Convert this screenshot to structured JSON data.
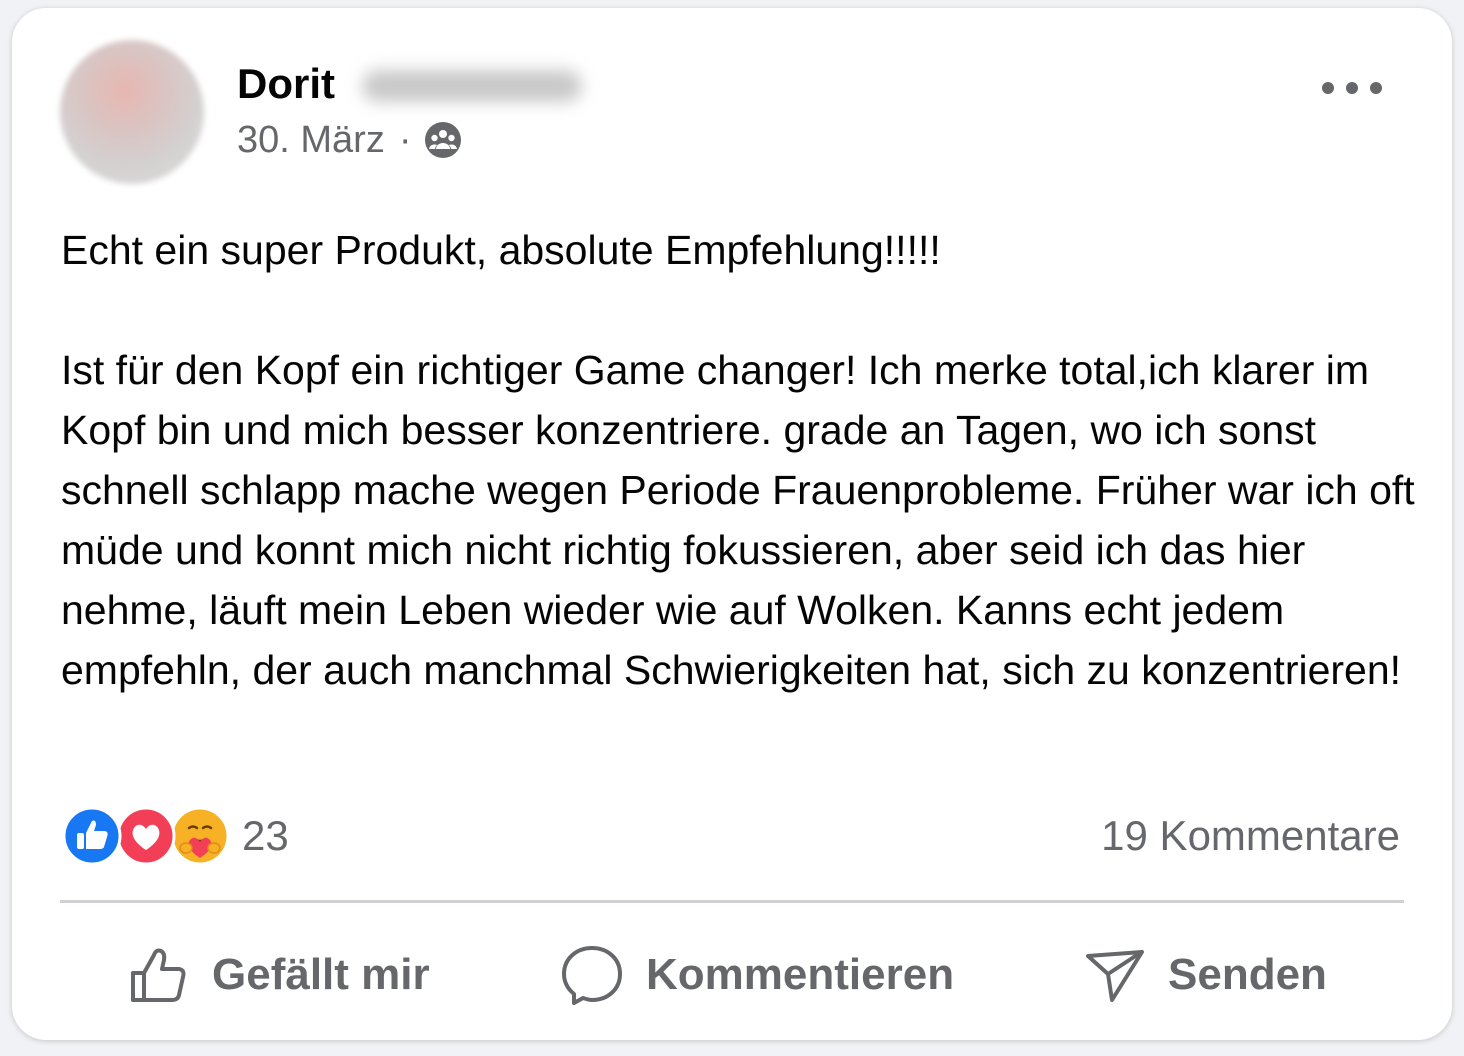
{
  "post": {
    "author_first_name": "Dorit",
    "date": "30. März",
    "separator": "·",
    "audience_icon": "group-icon",
    "more_icon": "more-options-icon",
    "paragraphs": [
      "Echt ein super Produkt, absolute Empfehlung!!!!!",
      "Ist für den Kopf ein richtiger Game changer! Ich merke total,ich klarer im Kopf bin und mich besser konzentriere. grade an Tagen, wo ich sonst schnell schlapp mache wegen Periode Frauenprobleme. Früher war ich oft müde und konnt mich nicht richtig fokussieren, aber seid ich das hier nehme, läuft mein Leben wieder wie auf Wolken. Kanns echt jedem empfehln, der auch manchmal Schwierigkeiten hat, sich zu konzentrieren!"
    ]
  },
  "reactions": {
    "icons": [
      "like-reaction-icon",
      "love-reaction-icon",
      "care-reaction-icon"
    ],
    "count": "23",
    "comments_label": "19 Kommentare"
  },
  "actions": {
    "like_label": "Gefällt mir",
    "comment_label": "Kommentieren",
    "send_label": "Senden"
  },
  "colors": {
    "like_blue": "#1877f2",
    "love_red": "#f33e58",
    "care_yellow": "#f7b125",
    "secondary_text": "#65676b",
    "divider": "#ced0d4"
  }
}
